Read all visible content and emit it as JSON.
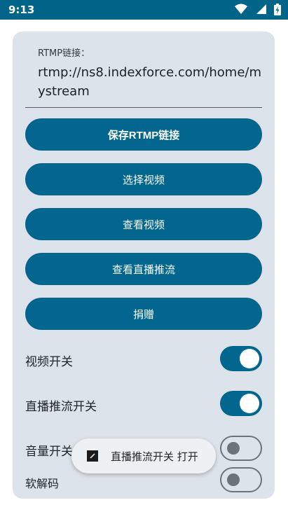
{
  "status_bar": {
    "time": "9:13",
    "icons": [
      "wifi-icon",
      "signal-icon",
      "battery-charging-icon"
    ],
    "color": "#03648a"
  },
  "form": {
    "rtmp_label": "RTMP链接：",
    "rtmp_value": "rtmp://ns8.indexforce.com/home/mystream"
  },
  "buttons": {
    "save": "保存RTMP链接",
    "select_video": "选择视频",
    "view_video": "查看视频",
    "view_stream": "查看直播推流",
    "donate": "捐赠"
  },
  "switches": [
    {
      "label": "视频开关",
      "on": true
    },
    {
      "label": "直播推流开关",
      "on": true
    },
    {
      "label": "音量开关",
      "on": false
    },
    {
      "label": "软解码",
      "on": false
    }
  ],
  "toast": {
    "text": "直播推流开关 打开"
  },
  "colors": {
    "accent": "#02668e",
    "card": "#dde3ea"
  }
}
